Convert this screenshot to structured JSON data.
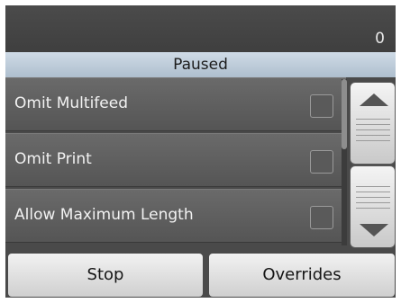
{
  "counter": "0",
  "status": "Paused",
  "options": [
    {
      "label": "Omit Multifeed",
      "checked": false
    },
    {
      "label": "Omit Print",
      "checked": false
    },
    {
      "label": "Allow Maximum Length",
      "checked": false
    }
  ],
  "buttons": {
    "stop": "Stop",
    "overrides": "Overrides"
  },
  "icons": {
    "scroll_up": "triangle-up",
    "scroll_down": "triangle-down"
  },
  "colors": {
    "status_bar": "#bfcedb",
    "list_background": "#5e5e5e",
    "button_face": "#e6e6e6"
  }
}
